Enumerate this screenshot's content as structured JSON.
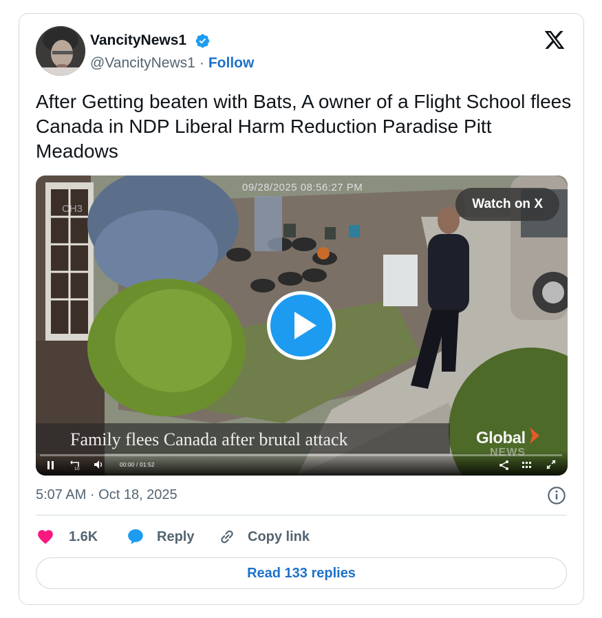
{
  "author": {
    "display_name": "VancityNews1",
    "handle": "@VancityNews1",
    "separator": "·",
    "follow_label": "Follow",
    "verified": true
  },
  "tweet": {
    "text": "After Getting beaten with Bats, A owner of a Flight School flees Canada in NDP Liberal Harm Reduction Paradise Pitt Meadows",
    "posted_at": "5:07 AM · Oct 18, 2025"
  },
  "media": {
    "camera_timestamp": "09/28/2025 08:56:27 PM",
    "camera_label": "CH3",
    "watch_label": "Watch on X",
    "caption": "Family flees Canada after brutal attack",
    "brand": "Global",
    "brand_sub": "NEWS",
    "time_display": "00:00 / 01:52",
    "progress": 0.0
  },
  "actions": {
    "likes": "1.6K",
    "reply_label": "Reply",
    "copy_label": "Copy link"
  },
  "read_replies_label": "Read 133 replies",
  "colors": {
    "like": "#f91880",
    "link": "#1d71c9",
    "play": "#1d9bf0",
    "verified": "#1d9bf0"
  }
}
